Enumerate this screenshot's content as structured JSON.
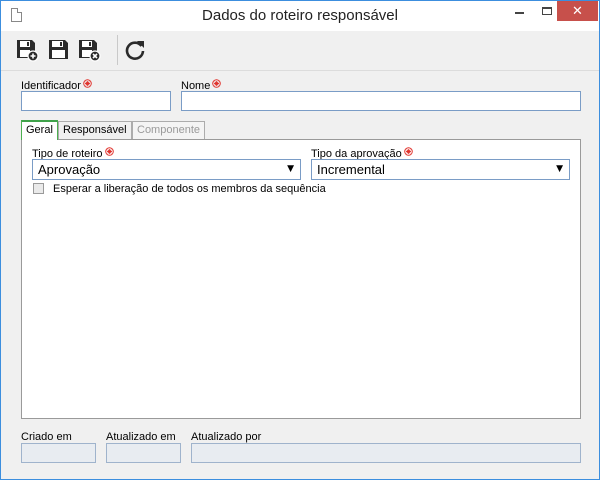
{
  "window": {
    "title": "Dados do roteiro responsável",
    "close_glyph": "✕"
  },
  "toolbar": {
    "buttons": [
      {
        "name": "save-new",
        "icon": "save-new-icon"
      },
      {
        "name": "save",
        "icon": "save-icon"
      },
      {
        "name": "save-close",
        "icon": "save-close-icon"
      },
      {
        "name": "refresh",
        "icon": "refresh-icon"
      }
    ]
  },
  "form": {
    "identificador_label": "Identificador",
    "identificador_value": "",
    "nome_label": "Nome",
    "nome_value": ""
  },
  "tabs": [
    {
      "label": "Geral",
      "state": "active"
    },
    {
      "label": "Responsável",
      "state": "normal"
    },
    {
      "label": "Componente",
      "state": "disabled"
    }
  ],
  "geral": {
    "tipo_roteiro_label": "Tipo de roteiro",
    "tipo_roteiro_value": "Aprovação",
    "tipo_aprovacao_label": "Tipo da aprovação",
    "tipo_aprovacao_value": "Incremental",
    "dropdown_glyph": "▼",
    "esperar_label": "Esperar a liberação de todos os membros da sequência",
    "esperar_checked": false
  },
  "footer": {
    "criado_em_label": "Criado em",
    "criado_em_value": "",
    "atualizado_em_label": "Atualizado em",
    "atualizado_em_value": "",
    "atualizado_por_label": "Atualizado por",
    "atualizado_por_value": ""
  },
  "colors": {
    "required_marker": "#e0312b",
    "accent_border": "#7a9cc6",
    "close_button": "#c7504b",
    "active_tab": "#3fa24a"
  }
}
